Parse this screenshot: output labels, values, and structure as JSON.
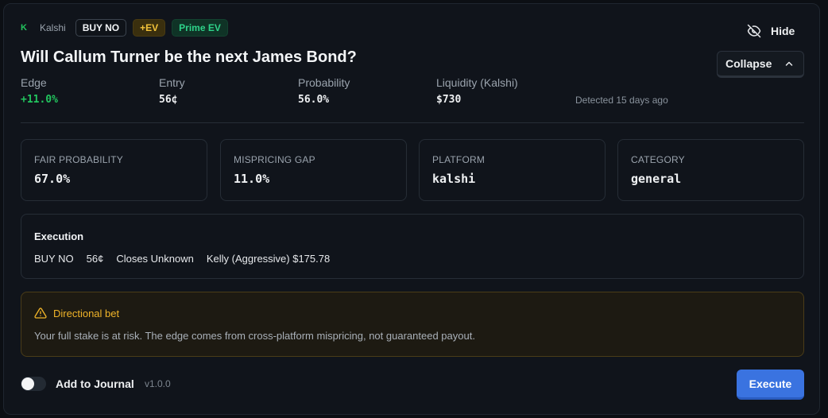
{
  "header": {
    "platform_logo": "K",
    "platform": "Kalshi",
    "side_badge": "BUY NO",
    "ev_badge": "+EV",
    "prime_badge": "Prime EV",
    "title": "Will Callum Turner be the next James Bond?",
    "hide_label": "Hide",
    "hide_icon": "eye-off-icon",
    "collapse_label": "Collapse",
    "collapse_icon": "chevron-up-icon"
  },
  "metrics": [
    {
      "label": "Edge",
      "value": "+11.0%"
    },
    {
      "label": "Entry",
      "value": "56¢"
    },
    {
      "label": "Probability",
      "value": "56.0%"
    },
    {
      "label": "Liquidity (Kalshi)",
      "value": "$730"
    }
  ],
  "detected": "Detected 15 days ago",
  "stats": [
    {
      "label": "FAIR PROBABILITY",
      "value": "67.0%"
    },
    {
      "label": "MISPRICING GAP",
      "value": "11.0%"
    },
    {
      "label": "PLATFORM",
      "value": "kalshi"
    },
    {
      "label": "CATEGORY",
      "value": "general"
    }
  ],
  "execution": {
    "title": "Execution",
    "side": "BUY NO",
    "price": "56¢",
    "closes": "Closes Unknown",
    "kelly": "Kelly (Aggressive) $175.78"
  },
  "warning": {
    "icon": "warning-triangle-icon",
    "title": "Directional bet",
    "text": "Your full stake is at risk. The edge comes from cross-platform mispricing, not guaranteed payout."
  },
  "footer": {
    "journal_label": "Add to Journal",
    "journal_enabled": false,
    "version": "v1.0.0",
    "execute_label": "Execute"
  },
  "colors": {
    "positive": "#22c55e",
    "accent": "#3a73e0",
    "warning": "#f0b429"
  }
}
